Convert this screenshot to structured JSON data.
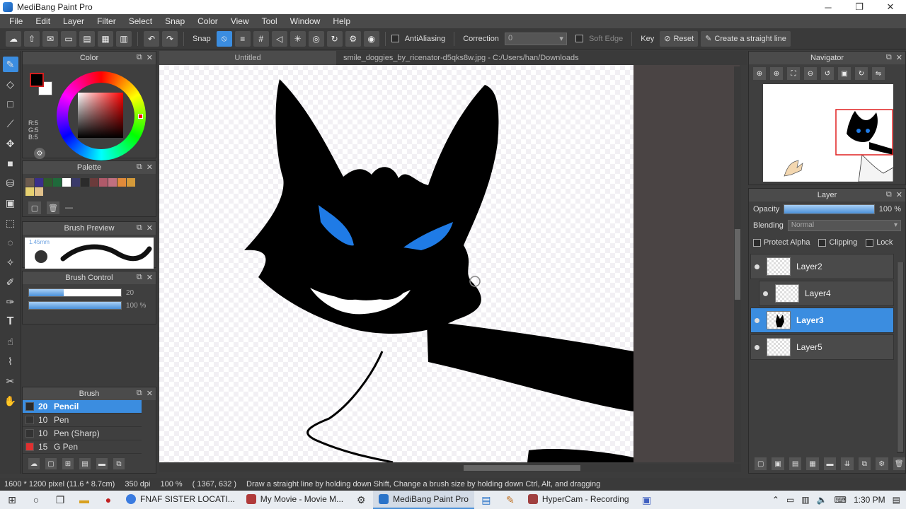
{
  "window": {
    "title": "MediBang Paint Pro",
    "minimize": "─",
    "maximize": "❐",
    "close": "✕"
  },
  "menu": [
    "File",
    "Edit",
    "Layer",
    "Filter",
    "Select",
    "Snap",
    "Color",
    "View",
    "Tool",
    "Window",
    "Help"
  ],
  "toolbar": {
    "snap_label": "Snap",
    "antialias_label": "AntiAliasing",
    "correction_label": "Correction",
    "correction_value": "0",
    "soft_edge_label": "Soft Edge",
    "key_label": "Key",
    "reset_label": "Reset",
    "straight_line_label": "Create a straight line"
  },
  "panels": {
    "color": {
      "title": "Color",
      "rgb": [
        "R:5",
        "G:5",
        "B:5"
      ],
      "fg": "#000000",
      "bg": "#ffffff"
    },
    "palette": {
      "title": "Palette",
      "swatches": [
        "#6b5a4e",
        "#3a2f8a",
        "#2e5b2e",
        "#1f6a3b",
        "#ffffff",
        "#3a3a6a",
        "#2b2b2b",
        "#6b3b3b",
        "#b05a6a",
        "#c07080",
        "#e08a3a",
        "#d49a3a",
        "#e6d070",
        "#e0c08a"
      ],
      "line_label": "—"
    },
    "brush_preview": {
      "title": "Brush Preview",
      "size": "1.45mm"
    },
    "brush_control": {
      "title": "Brush Control",
      "size_value": "20",
      "opacity_value": "100 %",
      "size_fraction": 0.38,
      "opacity_fraction": 1.0
    },
    "brush": {
      "title": "Brush",
      "items": [
        {
          "size": "20",
          "name": "Pencil",
          "chip": "#333333"
        },
        {
          "size": "10",
          "name": "Pen",
          "chip": "#333333"
        },
        {
          "size": "10",
          "name": "Pen (Sharp)",
          "chip": "#333333"
        },
        {
          "size": "15",
          "name": "G Pen",
          "chip": "#e03030"
        }
      ]
    },
    "navigator": {
      "title": "Navigator"
    },
    "layer": {
      "title": "Layer",
      "opacity_label": "Opacity",
      "opacity_value": "100 %",
      "blending_label": "Blending",
      "blending_value": "Normal",
      "protect_alpha": "Protect Alpha",
      "clipping": "Clipping",
      "lock": "Lock",
      "layers": [
        "Layer2",
        "Layer4",
        "Layer3",
        "Layer5"
      ]
    }
  },
  "documents": {
    "tab_inactive": "Untitled",
    "tab_active": "smile_doggies_by_ricenator-d5qks8w.jpg - C:/Users/han/Downloads"
  },
  "status": {
    "size": "1600 * 1200 pixel",
    "physical": "(11.6 * 8.7cm)",
    "dpi": "350 dpi",
    "zoom": "100 %",
    "coords": "( 1367, 632 )",
    "hint": "Draw a straight line by holding down Shift, Change a brush size by holding down Ctrl, Alt, and dragging"
  },
  "taskbar": {
    "apps": [
      {
        "label": "FNAF SISTER LOCATI...",
        "color": "#3a7be0"
      },
      {
        "label": "My Movie - Movie M...",
        "color": "#b03a3a"
      },
      {
        "label": "MediBang Paint Pro",
        "color": "#2a73c9"
      },
      {
        "label": "HyperCam - Recording",
        "color": "#a04040"
      }
    ],
    "time": "1:30 PM"
  },
  "colors": {
    "accent": "#3b8de0",
    "eyes": "#1f7be6"
  }
}
